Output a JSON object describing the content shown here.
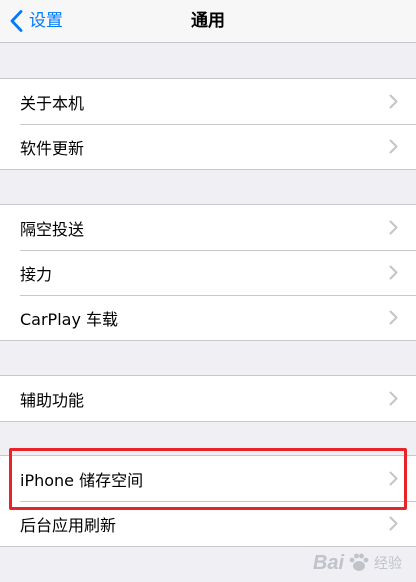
{
  "nav": {
    "back_label": "设置",
    "title": "通用"
  },
  "groups": [
    {
      "items": [
        {
          "label": "关于本机"
        },
        {
          "label": "软件更新"
        }
      ]
    },
    {
      "items": [
        {
          "label": "隔空投送"
        },
        {
          "label": "接力"
        },
        {
          "label": "CarPlay 车载"
        }
      ]
    },
    {
      "items": [
        {
          "label": "辅助功能"
        }
      ]
    },
    {
      "items": [
        {
          "label": "iPhone 储存空间"
        },
        {
          "label": "后台应用刷新"
        }
      ]
    }
  ],
  "highlight_color": "#e8242b",
  "accent_color": "#007aff",
  "watermark": {
    "text": "Bai",
    "sub": "经验"
  }
}
